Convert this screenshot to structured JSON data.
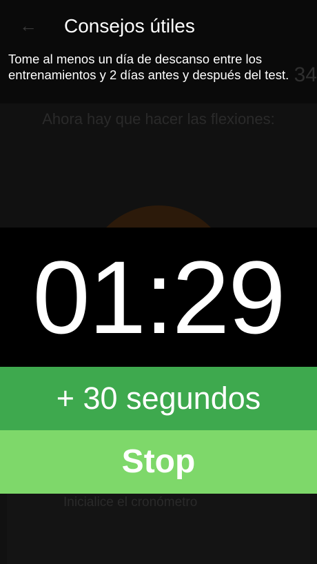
{
  "header": {
    "title": "Consejos útiles"
  },
  "tip": {
    "text": "Tome al menos un día de descanso entre los entrenamientos y 2 días antes y después del test."
  },
  "background": {
    "counter_partial": "34",
    "instruction": "Ahora hay que hacer las flexiones:",
    "hint": "Inicialice el cronómetro"
  },
  "timer": {
    "value": "01:29"
  },
  "buttons": {
    "add_time_label": "+ 30 segundos",
    "stop_label": "Stop"
  },
  "colors": {
    "add_button": "#3ea94e",
    "stop_button": "#7ed86a",
    "timer_background": "#000000"
  },
  "icons": {
    "back": "arrow-left-icon"
  }
}
